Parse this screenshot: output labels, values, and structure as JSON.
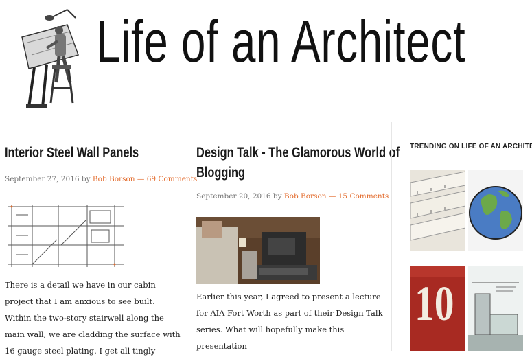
{
  "header": {
    "site_title": "Life of an Architect"
  },
  "posts": [
    {
      "title": "Interior Steel Wall Panels",
      "date": "September 27, 2016",
      "by": "by",
      "author": "Bob Borson",
      "separator": "—",
      "comments": "69 Comments",
      "excerpt": "There is a detail we have in our cabin project that I am anxious to see built. Within the two-story stairwell along the main wall, we are cladding the surface with 16 gauge steel plating. I get all tingly"
    },
    {
      "title_line1": "Design Talk - The Glamorous World of",
      "title_line2": "Blogging",
      "date": "September 20, 2016",
      "by": "by",
      "author": "Bob Borson",
      "separator": "—",
      "comments": "15 Comments",
      "excerpt": "Earlier this year, I agreed to present a lecture for AIA Fort Worth as part of their Design Talk series. What will hopefully make this presentation"
    }
  ],
  "sidebar": {
    "heading": "TRENDING ON LIFE OF AN ARCHITECT",
    "thumb_number": "10"
  },
  "colors": {
    "link": "#e36b2c",
    "text": "#222222"
  }
}
